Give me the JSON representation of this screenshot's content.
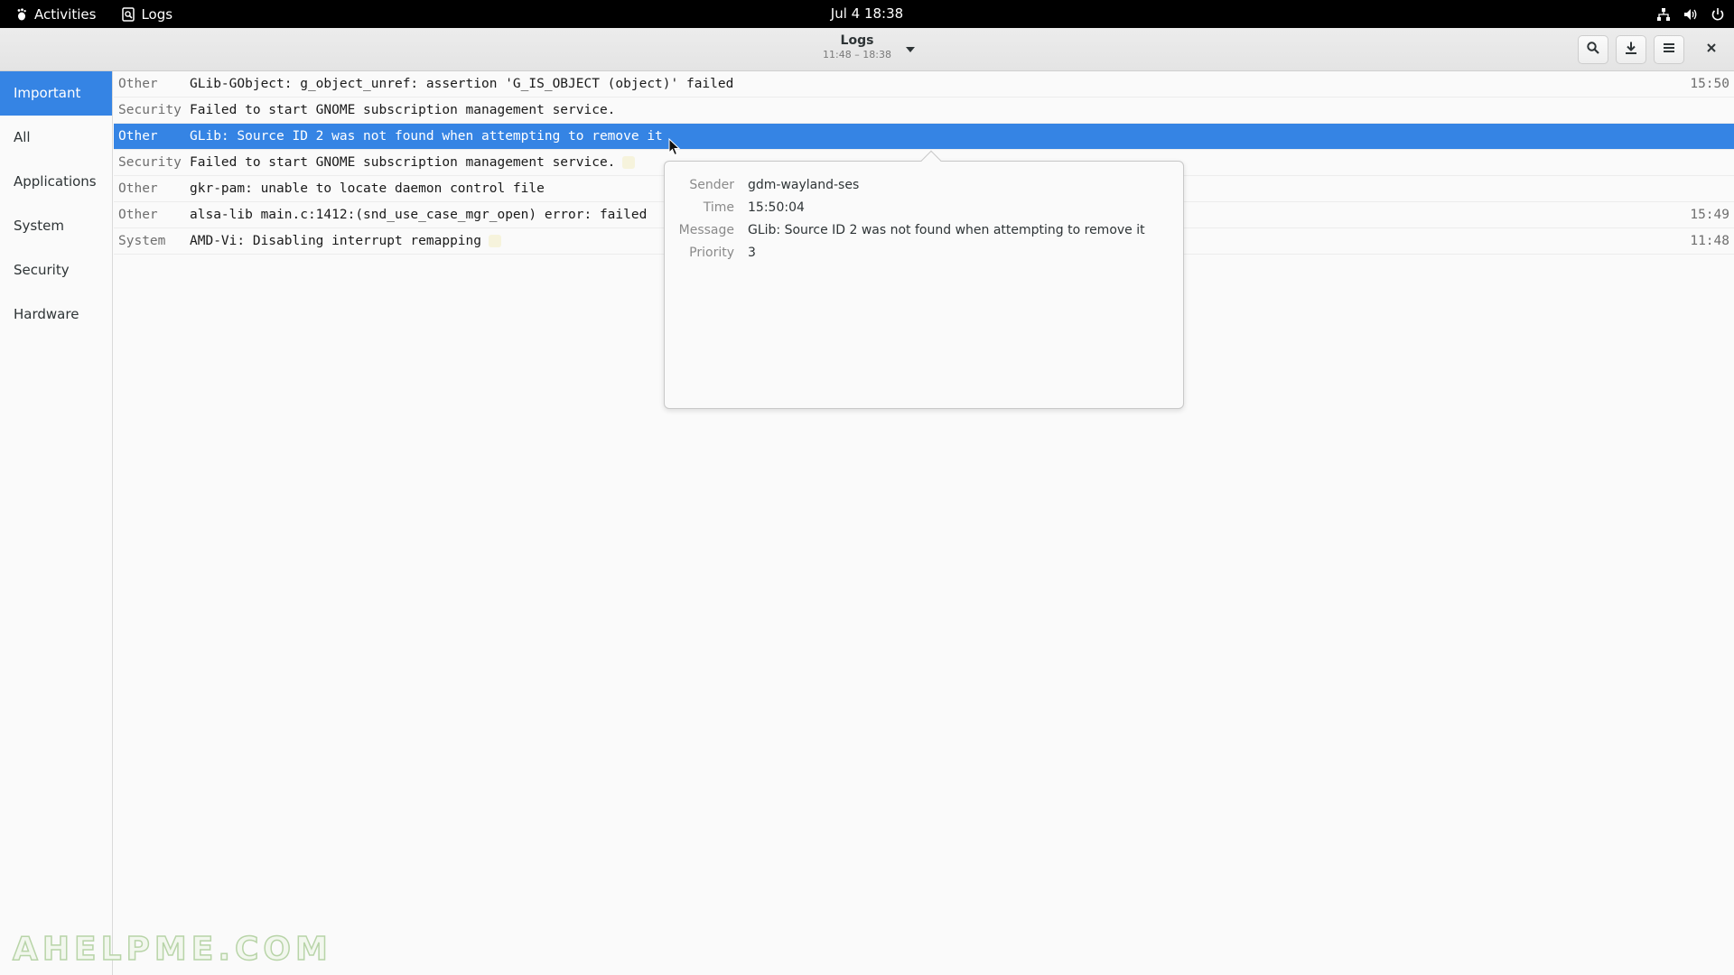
{
  "topbar": {
    "activities_label": "Activities",
    "app_label": "Logs",
    "clock": "Jul 4  18:38",
    "icons": [
      "network-icon",
      "volume-icon",
      "power-icon"
    ]
  },
  "header": {
    "title": "Logs",
    "subtitle": "11:48 – 18:38",
    "buttons": [
      "search-icon",
      "export-icon",
      "menu-icon",
      "close-icon"
    ]
  },
  "sidebar": {
    "items": [
      {
        "label": "Important",
        "active": true
      },
      {
        "label": "All"
      },
      {
        "label": "Applications"
      },
      {
        "label": "System"
      },
      {
        "label": "Security"
      },
      {
        "label": "Hardware"
      }
    ]
  },
  "logs": [
    {
      "category": "Other",
      "message": "GLib-GObject: g_object_unref: assertion 'G_IS_OBJECT (object)' failed",
      "time": "15:50"
    },
    {
      "category": "Security",
      "message": "Failed to start GNOME subscription management service.",
      "time": ""
    },
    {
      "category": "Other",
      "message": "GLib: Source ID 2 was not found when attempting to remove it",
      "time": "",
      "selected": true
    },
    {
      "category": "Security",
      "message": "Failed to start GNOME subscription management service.",
      "time": ""
    },
    {
      "category": "Other",
      "message": "gkr-pam: unable to locate daemon control file",
      "time": ""
    },
    {
      "category": "Other",
      "message": "alsa-lib main.c:1412:(snd_use_case_mgr_open) error: failed",
      "time": "15:49"
    },
    {
      "category": "System",
      "message": "AMD-Vi: Disabling interrupt remapping",
      "time": "11:48"
    }
  ],
  "detail": {
    "sender_label": "Sender",
    "sender": "gdm-wayland-ses",
    "time_label": "Time",
    "time": "15:50:04",
    "message_label": "Message",
    "message": "GLib: Source ID 2 was not found when attempting to remove it",
    "priority_label": "Priority",
    "priority": "3"
  },
  "watermark": "AHELPME.COM",
  "colors": {
    "accent": "#3584e4",
    "topbar": "#000000",
    "window_bg": "#fafafa"
  }
}
